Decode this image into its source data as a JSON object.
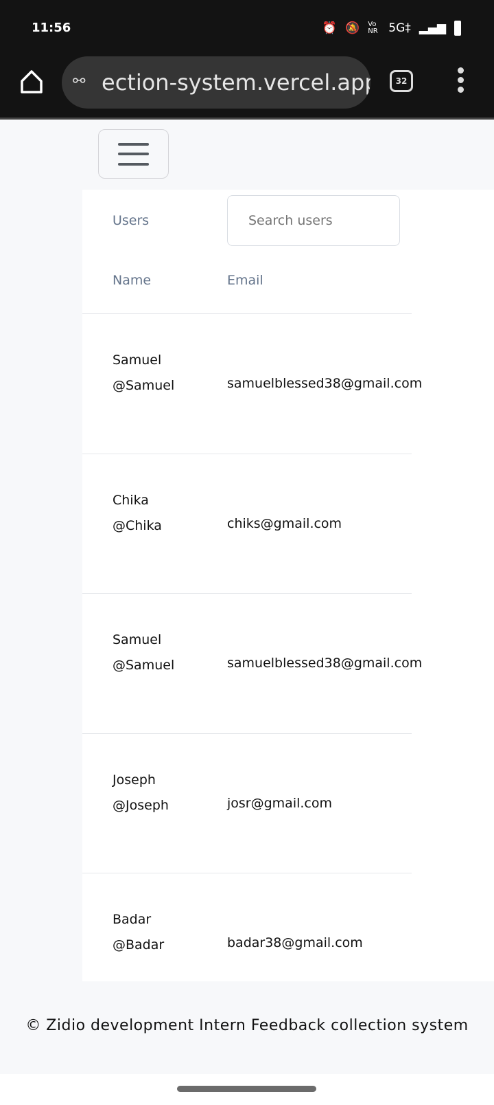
{
  "status_bar": {
    "time": "11:56",
    "icons": [
      "alarm-icon",
      "bell-off-icon",
      "vonr-icon",
      "5g-icon",
      "signal-icon",
      "battery-icon"
    ],
    "network": "5G‡",
    "vonr": "Vo NR"
  },
  "browser": {
    "url": "ection-system.vercel.app",
    "tab_count": "32"
  },
  "users": {
    "label": "Users",
    "search_placeholder": "Search users",
    "columns": [
      "Name",
      "Email"
    ],
    "rows": [
      {
        "name": "Samuel",
        "handle": "@Samuel",
        "email": "samuelblessed38@gmail.com"
      },
      {
        "name": "Chika",
        "handle": "@Chika",
        "email": "chiks@gmail.com"
      },
      {
        "name": "Samuel",
        "handle": "@Samuel",
        "email": "samuelblessed38@gmail.com"
      },
      {
        "name": "Joseph",
        "handle": "@Joseph",
        "email": "josr@gmail.com"
      },
      {
        "name": "Badar",
        "handle": "@Badar",
        "email": "badar38@gmail.com"
      }
    ]
  },
  "footer": {
    "text": "© Zidio development Intern Feedback collection system"
  }
}
